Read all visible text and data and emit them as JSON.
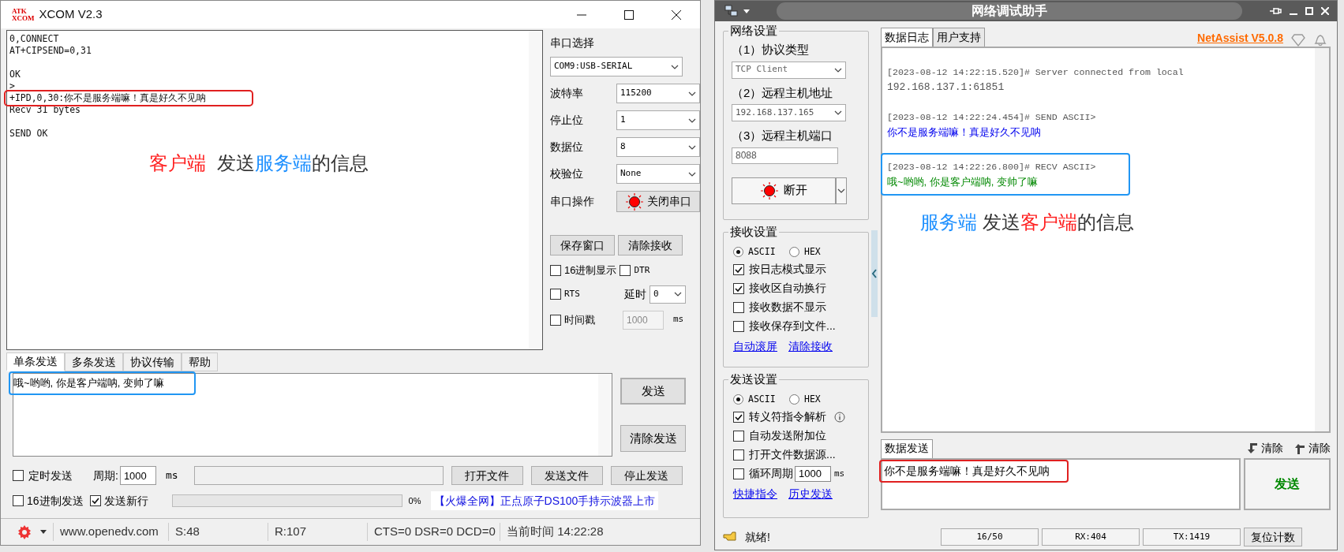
{
  "xcom": {
    "logo_top": "ATK",
    "logo_bottom": "XCOM",
    "title": "XCOM V2.3",
    "receive_blocks": [
      {
        "lines": [
          {
            "text": "0,CONNECT",
            "highlight": false
          },
          {
            "text": "AT+CIPSEND=0,31",
            "highlight": false
          }
        ]
      },
      {
        "lines": [
          {
            "text": "OK",
            "highlight": false
          },
          {
            "text": ">",
            "highlight": false
          },
          {
            "text": "+IPD,0,30:你不是服务端嘛！真是好久不见呐",
            "highlight": true
          },
          {
            "text": "Recv 31 bytes",
            "highlight": false
          }
        ]
      },
      {
        "lines": [
          {
            "text": "SEND OK",
            "highlight": false
          }
        ]
      }
    ],
    "caption": [
      {
        "text": "客户端",
        "color": "#ff2020"
      },
      {
        "text": " 发送",
        "color": "#333333"
      },
      {
        "text": "服务端",
        "color": "#1e90ff"
      },
      {
        "text": "的信息",
        "color": "#333333"
      }
    ],
    "port_label": "串口选择",
    "port_value": "COM9:USB-SERIAL",
    "settings": [
      {
        "label": "波特率",
        "value": "115200"
      },
      {
        "label": "停止位",
        "value": "1"
      },
      {
        "label": "数据位",
        "value": "8"
      },
      {
        "label": "校验位",
        "value": "None"
      }
    ],
    "op_label": "串口操作",
    "op_button": "关闭串口",
    "save_button": "保存窗口",
    "clear_button": "清除接收",
    "hex_display": {
      "label": "16进制显示",
      "checked": false
    },
    "dtr": {
      "label": "DTR",
      "checked": false
    },
    "rts": {
      "label": "RTS",
      "checked": false
    },
    "delay_label": "延时",
    "delay_value": "0",
    "timestamp": {
      "label": "时间戳",
      "checked": false
    },
    "timestamp_value": "1000",
    "timestamp_unit": "ms",
    "tabs": [
      {
        "label": "单条发送",
        "selected": true
      },
      {
        "label": "多条发送",
        "selected": false
      },
      {
        "label": "协议传输",
        "selected": false
      },
      {
        "label": "帮助",
        "selected": false
      }
    ],
    "send_text": "哦~哟哟, 你是客户端呐, 变帅了嘛",
    "send_highlight": true,
    "send_button": "发送",
    "clear_send_button": "清除发送",
    "timed_send": {
      "label": "定时发送",
      "checked": false
    },
    "period_label": "周期:",
    "period_value": "1000",
    "period_unit": "ms",
    "file_buttons": [
      "打开文件",
      "发送文件",
      "停止发送"
    ],
    "hex_send": {
      "label": "16进制发送",
      "checked": false
    },
    "new_line": {
      "label": "发送新行",
      "checked": true
    },
    "progress": {
      "level": 0
    },
    "progress_text": "0%",
    "ad_link": "【火爆全网】正点原子DS100手持示波器上市",
    "status_bar": [
      "www.openedv.com",
      "S:48",
      "R:107",
      "CTS=0 DSR=0 DCD=0",
      "当前时间 14:22:28"
    ]
  },
  "netassist": {
    "title": "网络调试助手",
    "net_group": "网络设置",
    "protocol_label": "（1）协议类型",
    "protocol_value": "TCP Client",
    "host_label": "（2）远程主机地址",
    "host_value": "192.168.137.165",
    "port_label": "（3）远程主机端口",
    "port_value": "8088",
    "connect_button": "断开",
    "recv_group": "接收设置",
    "recv_modes": [
      {
        "label": "ASCII",
        "selected": true
      },
      {
        "label": "HEX",
        "selected": false
      }
    ],
    "recv_options": [
      {
        "label": "按日志模式显示",
        "checked": true
      },
      {
        "label": "接收区自动换行",
        "checked": true
      },
      {
        "label": "接收数据不显示",
        "checked": false
      },
      {
        "label": "接收保存到文件...",
        "checked": false
      }
    ],
    "recv_links": [
      "自动滚屏",
      "清除接收"
    ],
    "send_group": "发送设置",
    "send_modes": [
      {
        "label": "ASCII",
        "selected": true
      },
      {
        "label": "HEX",
        "selected": false
      }
    ],
    "send_options": [
      {
        "label": "转义符指令解析",
        "checked": true
      },
      {
        "label": "自动发送附加位",
        "checked": false
      },
      {
        "label": "打开文件数据源...",
        "checked": false
      },
      {
        "label": "循环周期",
        "checked": false
      }
    ],
    "cycle_value": "1000",
    "cycle_unit": "ms",
    "send_links": [
      "快捷指令",
      "历史发送"
    ],
    "tabs": [
      {
        "label": "数据日志",
        "selected": true
      },
      {
        "label": "用户支持",
        "selected": false
      }
    ],
    "brand": "NetAssist V5.0.8",
    "log": [
      {
        "kind": "info",
        "header": "[2023-08-12 14:22:15.520]# Server connected from local",
        "body": "192.168.137.1:61851",
        "highlight": false
      },
      {
        "kind": "send",
        "header": "[2023-08-12 14:22:24.454]# SEND ASCII>",
        "body": "你不是服务端嘛！真是好久不见呐",
        "highlight": false
      },
      {
        "kind": "recv",
        "header": "[2023-08-12 14:22:26.800]# RECV ASCII>",
        "body": "哦~哟哟, 你是客户端呐, 变帅了嘛",
        "highlight": true
      }
    ],
    "caption": [
      {
        "text": "服务端",
        "color": "#1e90ff"
      },
      {
        "text": " 发送",
        "color": "#333333"
      },
      {
        "text": "客户端",
        "color": "#ff2020"
      },
      {
        "text": "的信息",
        "color": "#333333"
      }
    ],
    "send_tab": "数据发送",
    "clear_buttons": [
      "清除",
      "清除"
    ],
    "send_text": "你不是服务端嘛！真是好久不见呐",
    "send_highlight": true,
    "send_button": "发送",
    "status": "就绪!",
    "counters": [
      "16/50",
      "RX:404",
      "TX:1419"
    ],
    "reset_button": "复位计数"
  }
}
